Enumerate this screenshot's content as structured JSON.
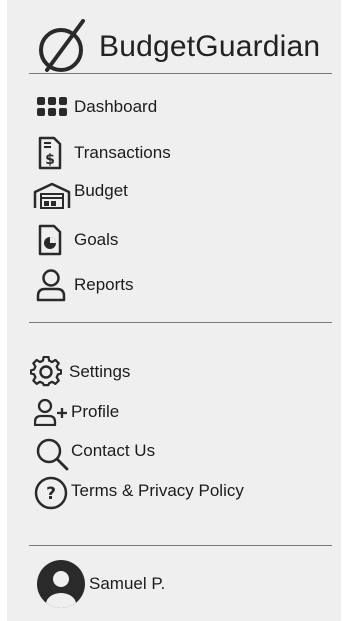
{
  "app": {
    "name": "BudgetGuardian"
  },
  "nav_primary": [
    {
      "label": "Dashboard",
      "icon": "dashboard-grid-icon"
    },
    {
      "label": "Transactions",
      "icon": "receipt-dollar-icon"
    },
    {
      "label": "Budget",
      "icon": "warehouse-icon"
    },
    {
      "label": "Goals",
      "icon": "pie-chart-file-icon"
    },
    {
      "label": "Reports",
      "icon": "person-icon"
    }
  ],
  "nav_secondary": [
    {
      "label": "Settings",
      "icon": "gear-icon"
    },
    {
      "label": "Profile",
      "icon": "add-user-icon"
    },
    {
      "label": "Contact Us",
      "icon": "search-icon"
    },
    {
      "label": "Terms & Privacy Policy",
      "icon": "question-circle-icon"
    }
  ],
  "user": {
    "name": "Samuel P.",
    "icon": "avatar-icon"
  }
}
